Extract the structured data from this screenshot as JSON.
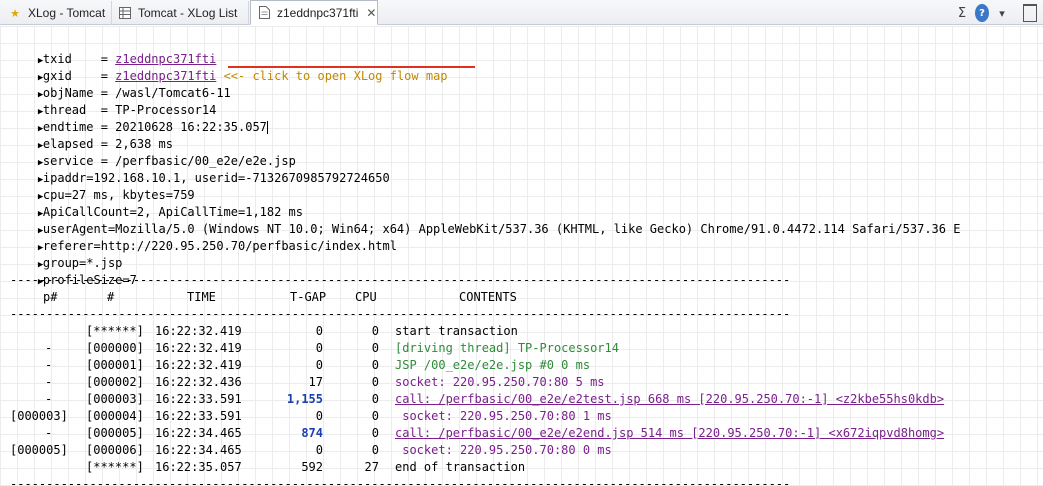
{
  "tabs": [
    {
      "label": "XLog - Tomcat",
      "icon": "star-icon"
    },
    {
      "label": "Tomcat - XLog List",
      "icon": "table-icon"
    },
    {
      "label": "z1eddnpc371fti",
      "icon": "document-icon",
      "close": "✕"
    }
  ],
  "toolbar": {
    "sigma": "Σ",
    "help": "?",
    "dropdown": "▾"
  },
  "props": [
    {
      "key": "txid",
      "sep": "    = ",
      "value": "z1eddnpc371fti",
      "link": true
    },
    {
      "key": "gxid",
      "sep": "    = ",
      "value": "z1eddnpc371fti",
      "link": true,
      "hint": "<<- click to open XLog flow map"
    },
    {
      "key": "objName",
      "sep": " = ",
      "value": "/wasl/Tomcat6-11"
    },
    {
      "key": "thread",
      "sep": "  = ",
      "value": "TP-Processor14"
    },
    {
      "key": "endtime",
      "sep": " = ",
      "value": "20210628 16:22:35.057",
      "caret": true
    },
    {
      "key": "elapsed",
      "sep": " = ",
      "value": "2,638 ms"
    },
    {
      "key": "service",
      "sep": " = ",
      "value": "/perfbasic/00_e2e/e2e.jsp"
    },
    {
      "key": "ipaddr",
      "sep": "=",
      "value": "192.168.10.1, userid=-7132670985792724650"
    },
    {
      "key": "cpu",
      "sep": "=",
      "value": "27 ms, kbytes=759"
    },
    {
      "key": "ApiCallCount",
      "sep": "=",
      "value": "2, ApiCallTime=1,182 ms"
    },
    {
      "key": "userAgent",
      "sep": "=",
      "value": "Mozilla/5.0 (Windows NT 10.0; Win64; x64) AppleWebKit/537.36 (KHTML, like Gecko) Chrome/91.0.4472.114 Safari/537.36 E"
    },
    {
      "key": "referer",
      "sep": "=",
      "value": "http://220.95.250.70/perfbasic/index.html"
    },
    {
      "key": "group",
      "sep": "=",
      "value": "*.jsp"
    },
    {
      "key": "profileSize",
      "sep": "=",
      "value": "7"
    }
  ],
  "separator": "------------------------------------------------------------------------------------------------------------",
  "columns": {
    "p": "p#",
    "n": "#",
    "time": "TIME",
    "tgap": "T-GAP",
    "cpu": "CPU",
    "contents": "CONTENTS"
  },
  "rows": [
    {
      "p": "",
      "n": "[******]",
      "time": "16:22:32.419",
      "tgap": "0",
      "cpu": "0",
      "contents": "start transaction",
      "style": "plain"
    },
    {
      "p": "-",
      "n": "[000000]",
      "time": "16:22:32.419",
      "tgap": "0",
      "cpu": "0",
      "contents": "[driving thread] TP-Processor14",
      "style": "green"
    },
    {
      "p": "-",
      "n": "[000001]",
      "time": "16:22:32.419",
      "tgap": "0",
      "cpu": "0",
      "contents": "JSP /00_e2e/e2e.jsp #0 0 ms",
      "style": "green"
    },
    {
      "p": "-",
      "n": "[000002]",
      "time": "16:22:32.436",
      "tgap": "17",
      "cpu": "0",
      "contents": "socket: 220.95.250.70:80 5 ms",
      "style": "purple"
    },
    {
      "p": "-",
      "n": "[000003]",
      "time": "16:22:33.591",
      "tgap": "1,155",
      "cpu": "0",
      "contents": "call: /perfbasic/00_e2e/e2test.jsp 668 ms [220.95.250.70:-1] <z2kbe55hs0kdb>",
      "style": "plink",
      "tgapBlue": true
    },
    {
      "p": "[000003]",
      "n": "[000004]",
      "time": "16:22:33.591",
      "tgap": "0",
      "cpu": "0",
      "contents": " socket: 220.95.250.70:80 1 ms",
      "style": "purple"
    },
    {
      "p": "-",
      "n": "[000005]",
      "time": "16:22:34.465",
      "tgap": "874",
      "cpu": "0",
      "contents": "call: /perfbasic/00_e2e/e2end.jsp 514 ms [220.95.250.70:-1] <x672iqpvd8homg>",
      "style": "plink",
      "tgapBlue": true
    },
    {
      "p": "[000005]",
      "n": "[000006]",
      "time": "16:22:34.465",
      "tgap": "0",
      "cpu": "0",
      "contents": " socket: 220.95.250.70:80 0 ms",
      "style": "purple"
    },
    {
      "p": "",
      "n": "[******]",
      "time": "16:22:35.057",
      "tgap": "592",
      "cpu": "27",
      "contents": "end of transaction",
      "style": "plain"
    }
  ]
}
